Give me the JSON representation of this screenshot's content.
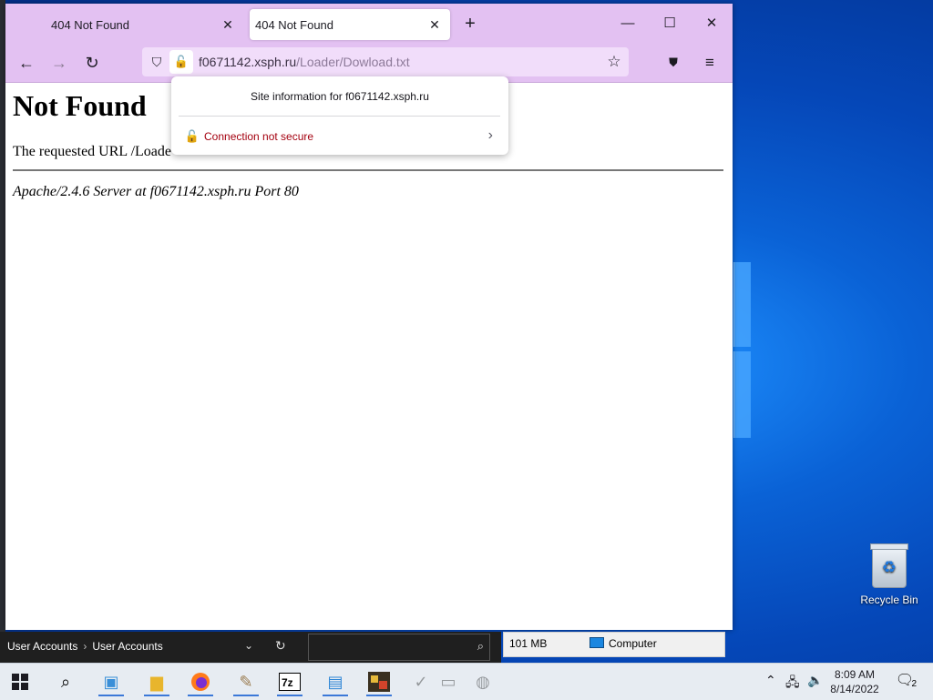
{
  "browser": {
    "tabs": [
      {
        "title": "404 Not Found",
        "active": false
      },
      {
        "title": "404 Not Found",
        "active": true
      }
    ],
    "new_tab_icon": "plus-icon",
    "window_controls": {
      "minimize": "—",
      "maximize": "☐",
      "close": "✕"
    },
    "nav": {
      "back": "←",
      "forward": "→",
      "reload": "↻"
    },
    "url": {
      "host": "f0671142.xsph.ru",
      "path": "/Loader/Dowload.txt"
    }
  },
  "popup": {
    "title": "Site information for f0671142.xsph.ru",
    "row_label": "Connection not secure"
  },
  "page": {
    "heading": "Not Found",
    "message": "The requested URL /Loade",
    "address": "Apache/2.4.6 Server at f0671142.xsph.ru Port 80"
  },
  "desktop": {
    "recycle_bin_label": "Recycle Bin"
  },
  "explorer": {
    "breadcrumb": [
      "User Accounts",
      "User Accounts"
    ],
    "status_size": "101 MB",
    "status_location": "Computer"
  },
  "taskbar": {
    "time": "8:09 AM",
    "date": "8/14/2022",
    "notification_count": "2",
    "accent": "#3b78d8"
  }
}
